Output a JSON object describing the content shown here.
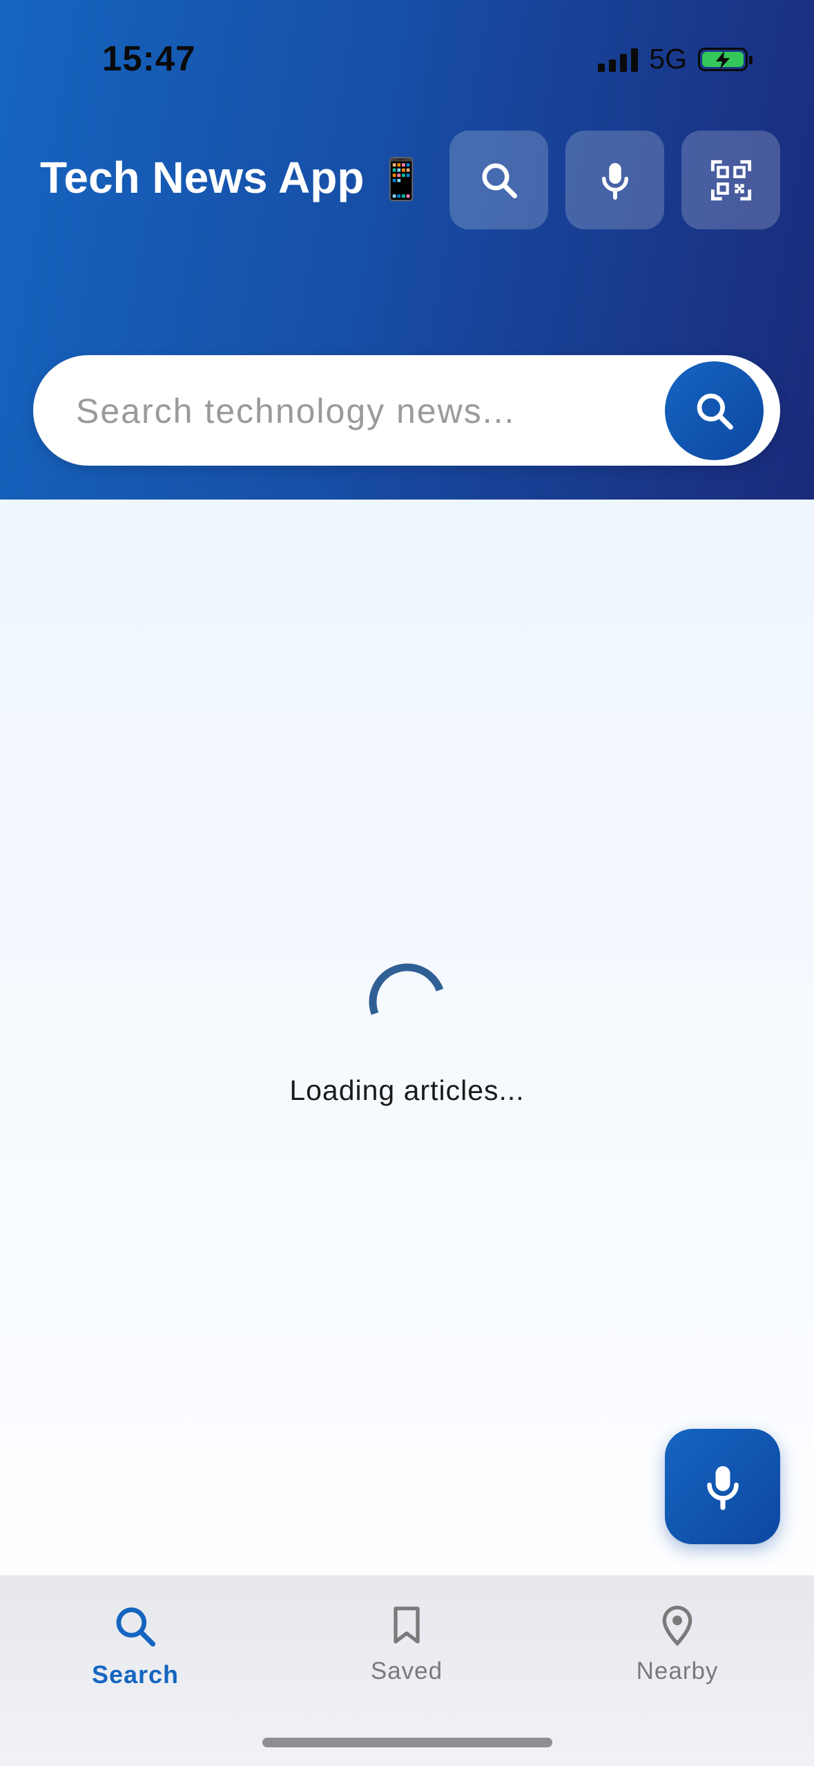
{
  "status_bar": {
    "time": "15:47",
    "network": "5G"
  },
  "header": {
    "title": "Tech News App",
    "title_emoji": "📱",
    "actions": [
      {
        "icon": "search-icon"
      },
      {
        "icon": "microphone-icon"
      },
      {
        "icon": "qr-code-icon"
      }
    ]
  },
  "search": {
    "placeholder": "Search technology news...",
    "value": "",
    "submit_icon": "search-icon"
  },
  "main": {
    "loading_text": "Loading articles..."
  },
  "fab": {
    "icon": "microphone-icon"
  },
  "tabs": [
    {
      "label": "Search",
      "icon": "search-icon",
      "active": true
    },
    {
      "label": "Saved",
      "icon": "bookmark-icon",
      "active": false
    },
    {
      "label": "Nearby",
      "icon": "location-pin-icon",
      "active": false
    }
  ],
  "colors": {
    "primary": "#1565c0",
    "primary_dark": "#0d47a1",
    "header_end": "#1a2a7a",
    "spinner": "#2f5f94",
    "tab_inactive": "#7a7a7a",
    "battery": "#34c759"
  }
}
